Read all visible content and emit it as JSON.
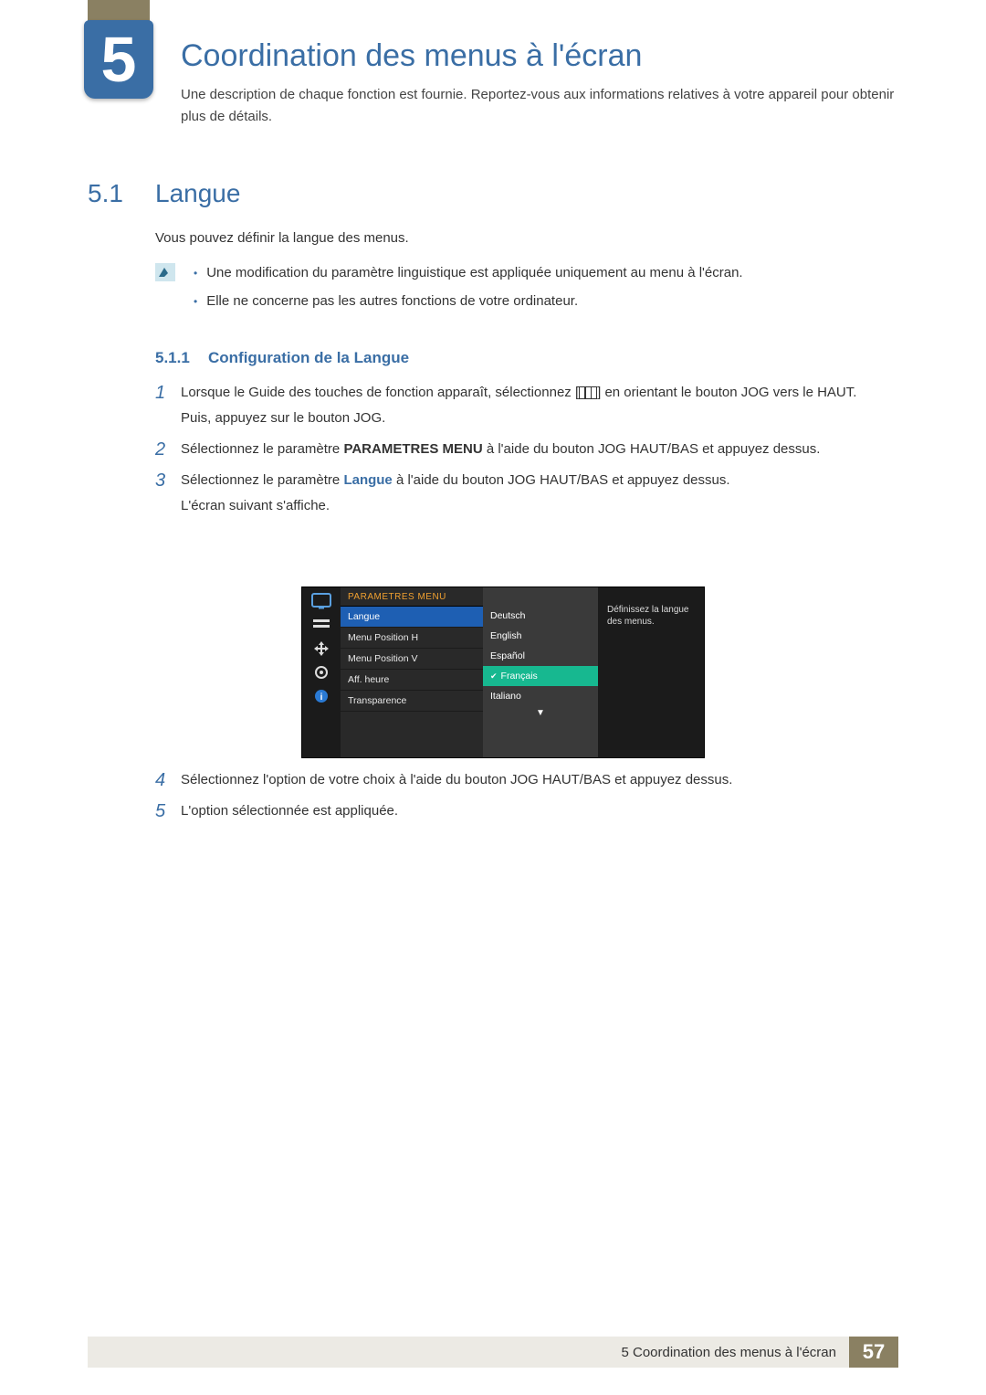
{
  "chapter": {
    "number": "5",
    "title": "Coordination des menus à l'écran",
    "description": "Une description de chaque fonction est fournie. Reportez-vous aux informations relatives à votre appareil pour obtenir plus de détails."
  },
  "section": {
    "number": "5.1",
    "title": "Langue",
    "intro": "Vous pouvez définir la langue des menus.",
    "notes": [
      "Une modification du paramètre linguistique est appliquée uniquement au menu à l'écran.",
      "Elle ne concerne pas les autres fonctions de votre ordinateur."
    ]
  },
  "subsection": {
    "number": "5.1.1",
    "title": "Configuration de la Langue"
  },
  "steps": {
    "s1a": "Lorsque le Guide des touches de fonction apparaît, sélectionnez [",
    "s1b": "] en orientant le bouton JOG vers le HAUT.",
    "s1c": "Puis, appuyez sur le bouton JOG.",
    "s2a": "Sélectionnez le paramètre ",
    "s2bold": "PARAMETRES MENU",
    "s2b": " à l'aide du bouton JOG HAUT/BAS et appuyez dessus.",
    "s3a": "Sélectionnez le paramètre ",
    "s3bold": "Langue",
    "s3b": " à l'aide du bouton JOG HAUT/BAS et appuyez dessus.",
    "s3c": "L'écran suivant s'affiche.",
    "s4": "Sélectionnez l'option de votre choix à l'aide du bouton JOG HAUT/BAS et appuyez dessus.",
    "s5": "L'option sélectionnée est appliquée."
  },
  "step_numbers": {
    "n1": "1",
    "n2": "2",
    "n3": "3",
    "n4": "4",
    "n5": "5"
  },
  "osd": {
    "header": "PARAMETRES MENU",
    "menu_items": [
      "Langue",
      "Menu Position H",
      "Menu Position V",
      "Aff. heure",
      "Transparence"
    ],
    "languages": [
      "Deutsch",
      "English",
      "Español",
      "Français",
      "Italiano"
    ],
    "selected_language_index": 3,
    "help": "Définissez la langue des menus."
  },
  "footer": {
    "text": "5 Coordination des menus à l'écran",
    "page": "57"
  },
  "colors": {
    "accent": "#3a6ea5",
    "khaki": "#8a8062",
    "osd_sel": "#1e5fb3",
    "osd_lang_sel": "#17b890"
  }
}
